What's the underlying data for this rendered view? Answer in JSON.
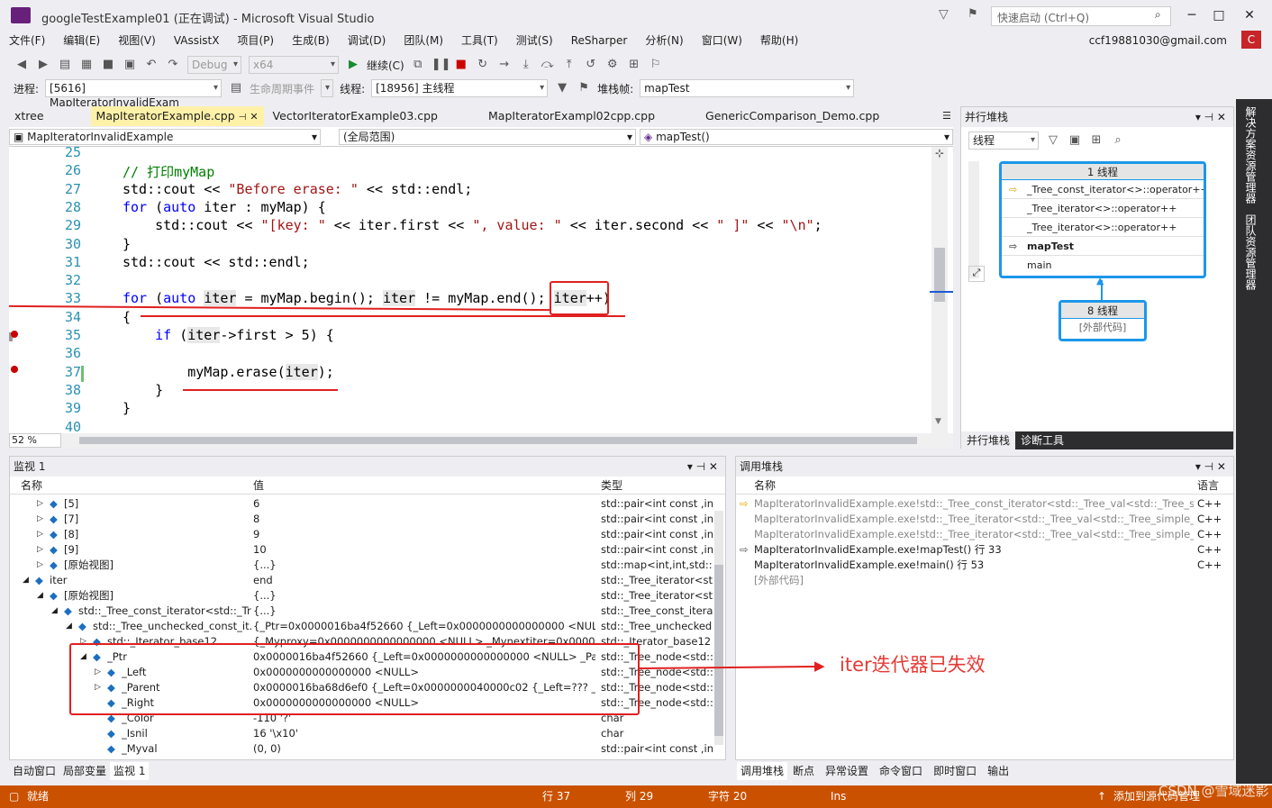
{
  "window": {
    "title": "googleTestExample01 (正在调试) - Microsoft Visual Studio",
    "quick_launch": "快速启动 (Ctrl+Q)",
    "account": "ccf19881030@gmail.com",
    "account_initial": "C"
  },
  "menu": [
    "文件(F)",
    "编辑(E)",
    "视图(V)",
    "VAssistX",
    "项目(P)",
    "生成(B)",
    "调试(D)",
    "团队(M)",
    "工具(T)",
    "测试(S)",
    "ReSharper",
    "分析(N)",
    "窗口(W)",
    "帮助(H)"
  ],
  "toolbar": {
    "config": "Debug",
    "platform": "x64",
    "continue": "继续(C)",
    "process_label": "进程:",
    "process": "[5616] MapIteratorInvalidExam",
    "lifecycle": "生命周期事件",
    "thread_label": "线程:",
    "thread": "[18956] 主线程",
    "stackframe_label": "堆栈帧:",
    "stackframe": "mapTest"
  },
  "tabs": [
    "xtree",
    "MapIteratorExample.cpp",
    "VectorIteratorExample03.cpp",
    "MapIteratorExampl02cpp.cpp",
    "GenericComparison_Demo.cpp"
  ],
  "navbar": {
    "project": "MapIteratorInvalidExample",
    "scope": "(全局范围)",
    "function": "mapTest()"
  },
  "editor": {
    "zoom": "52 %",
    "lines": [
      {
        "n": "25",
        "html": ""
      },
      {
        "n": "26",
        "html": "<span class='cm'>// 打印myMap</span>"
      },
      {
        "n": "27",
        "html": "std::cout &lt;&lt; <span class='str'>\"Before erase: \"</span> &lt;&lt; std::endl;"
      },
      {
        "n": "28",
        "html": "<span class='kw'>for</span> (<span class='kw'>auto</span> iter : myMap) {"
      },
      {
        "n": "29",
        "html": "    std::cout &lt;&lt; <span class='str'>\"[key: \"</span> &lt;&lt; iter.first &lt;&lt; <span class='str'>\", value: \"</span> &lt;&lt; iter.second &lt;&lt; <span class='str'>\" ]\"</span> &lt;&lt; <span class='str'>\"\\n\"</span>;"
      },
      {
        "n": "30",
        "html": "}"
      },
      {
        "n": "31",
        "html": "std::cout &lt;&lt; std::endl;"
      },
      {
        "n": "32",
        "html": ""
      },
      {
        "n": "33",
        "html": "<span class='kw'>for</span> (<span class='kw'>auto</span> <span class='hl'>iter</span> = myMap.begin(); <span class='hl'>iter</span> != myMap.end(); <span class='hl'>iter</span>++)"
      },
      {
        "n": "34",
        "html": "{"
      },
      {
        "n": "35",
        "html": "    <span class='kw'>if</span> (<span class='hl'>iter</span>-&gt;first &gt; 5) {"
      },
      {
        "n": "36",
        "html": ""
      },
      {
        "n": "37",
        "html": "        myMap.erase(<span class='hl'>iter</span>);"
      },
      {
        "n": "38",
        "html": "    }"
      },
      {
        "n": "39",
        "html": "}"
      },
      {
        "n": "40",
        "html": ""
      }
    ]
  },
  "parallel_stacks": {
    "title": "并行堆栈",
    "view": "线程",
    "box1_header": "1 线程",
    "box1_frames": [
      "_Tree_const_iterator<>::operator++",
      "_Tree_iterator<>::operator++",
      "_Tree_iterator<>::operator++",
      "mapTest",
      "main"
    ],
    "box2_header": "8 线程",
    "box2_frames": [
      "[外部代码]"
    ],
    "tabs": [
      "并行堆栈",
      "诊断工具"
    ]
  },
  "watch": {
    "title": "监视 1",
    "columns": [
      "名称",
      "值",
      "类型"
    ],
    "rows": [
      {
        "indent": 2,
        "name": "[5]",
        "value": "6",
        "type": "std::pair<int const ,in..."
      },
      {
        "indent": 2,
        "name": "[7]",
        "value": "8",
        "type": "std::pair<int const ,in..."
      },
      {
        "indent": 2,
        "name": "[8]",
        "value": "9",
        "type": "std::pair<int const ,in..."
      },
      {
        "indent": 2,
        "name": "[9]",
        "value": "10",
        "type": "std::pair<int const ,in..."
      },
      {
        "indent": 2,
        "name": "[原始视图]",
        "value": "{...}",
        "type": "std::map<int,int,std::l..."
      },
      {
        "indent": 1,
        "name": "iter",
        "value": "end",
        "type": "std::_Tree_iterator<st..."
      },
      {
        "indent": 2,
        "name": "[原始视图]",
        "value": "{...}",
        "type": "std::_Tree_iterator<st..."
      },
      {
        "indent": 3,
        "name": "std::_Tree_const_iterator<std::_Tre...",
        "value": "{...}",
        "type": "std::_Tree_const_iterat..."
      },
      {
        "indent": 4,
        "name": "std::_Tree_unchecked_const_it...",
        "value": "{_Ptr=0x0000016ba4f52660 {_Left=0x0000000000000000 <NULL> _Pare...",
        "type": "std::_Tree_unchecked..."
      },
      {
        "indent": 5,
        "name": "std::_Iterator_base12",
        "value": "{_Myproxy=0x0000000000000000 <NULL> _Mynextiter=0x00000000000...",
        "type": "std::_Iterator_base12"
      },
      {
        "indent": 5,
        "name": "_Ptr",
        "value": "0x0000016ba4f52660 {_Left=0x0000000000000000 <NULL> _Parent=0x0...",
        "type": "std::_Tree_node<std::..."
      },
      {
        "indent": 6,
        "name": "_Left",
        "value": "0x0000000000000000 <NULL>",
        "type": "std::_Tree_node<std::..."
      },
      {
        "indent": 6,
        "name": "_Parent",
        "value": "0x0000016ba68d6ef0 {_Left=0x0000000040000c02 {_Left=??? _Parent=??...",
        "type": "std::_Tree_node<std::..."
      },
      {
        "indent": 6,
        "name": "_Right",
        "value": "0x0000000000000000 <NULL>",
        "type": "std::_Tree_node<std::..."
      },
      {
        "indent": 6,
        "name": "_Color",
        "value": "-110 '?'",
        "type": "char"
      },
      {
        "indent": 6,
        "name": "_Isnil",
        "value": "16 '\\x10'",
        "type": "char"
      },
      {
        "indent": 6,
        "name": "_Myval",
        "value": "(0, 0)",
        "type": "std::pair<int const ,in..."
      }
    ],
    "tabs": [
      "自动窗口",
      "局部变量",
      "监视 1"
    ]
  },
  "callstack": {
    "title": "调用堆栈",
    "columns": [
      "名称",
      "语言"
    ],
    "rows": [
      {
        "name": "MapIteratorInvalidExample.exe!std::_Tree_const_iterator<std::_Tree_val<std::_Tree_simple_t...",
        "lang": "C++"
      },
      {
        "name": "MapIteratorInvalidExample.exe!std::_Tree_iterator<std::_Tree_val<std::_Tree_simple_types<s...",
        "lang": "C++"
      },
      {
        "name": "MapIteratorInvalidExample.exe!std::_Tree_iterator<std::_Tree_val<std::_Tree_simple_types<s...",
        "lang": "C++"
      },
      {
        "name": "MapIteratorInvalidExample.exe!mapTest() 行 33",
        "lang": "C++"
      },
      {
        "name": "MapIteratorInvalidExample.exe!main() 行 53",
        "lang": "C++"
      },
      {
        "name": "[外部代码]",
        "lang": ""
      }
    ],
    "tabs": [
      "调用堆栈",
      "断点",
      "异常设置",
      "命令窗口",
      "即时窗口",
      "输出"
    ]
  },
  "annotation": "iter迭代器已失效",
  "sidebar": [
    "解决方案资源管理器",
    "团队资源管理器"
  ],
  "status": {
    "ready": "就绪",
    "line": "行 37",
    "col": "列 29",
    "char": "字符 20",
    "mode": "Ins",
    "publish": "添加到源代码管理",
    "watermark": "CSDN @雪域迷影"
  }
}
